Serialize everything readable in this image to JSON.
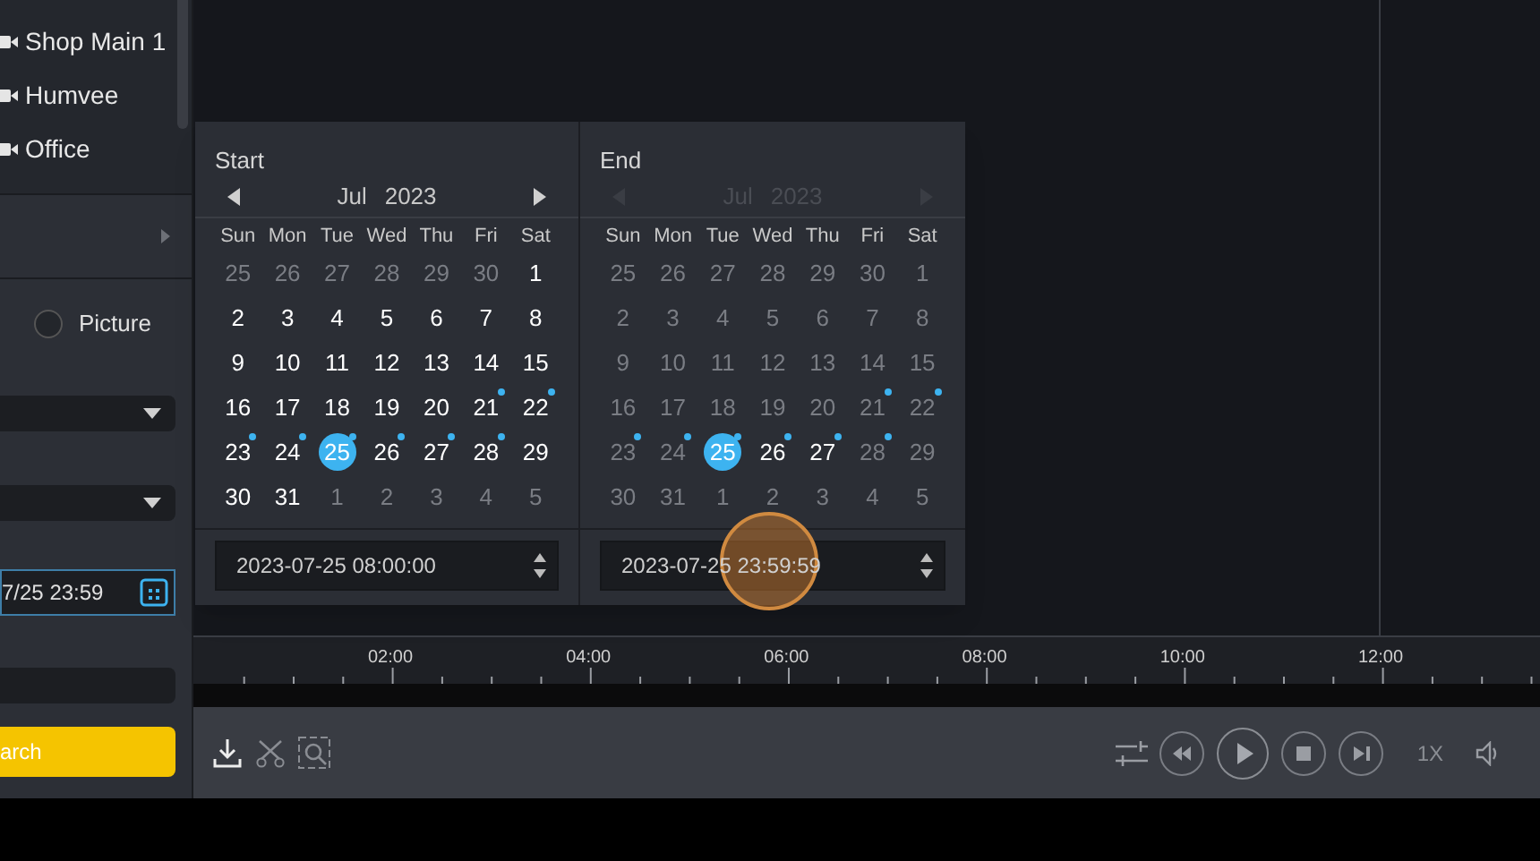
{
  "cameras": [
    {
      "label": "Shop Main 1"
    },
    {
      "label": "Humvee"
    },
    {
      "label": "Office"
    }
  ],
  "record_type": {
    "label": "Picture",
    "selected": false
  },
  "time_field": {
    "value": "7/25 23:59"
  },
  "search_button": {
    "label": "arch"
  },
  "calendars": [
    {
      "title": "Start",
      "month": "Jul",
      "year": "2023",
      "nav": true,
      "weekdays": [
        "Sun",
        "Mon",
        "Tue",
        "Wed",
        "Thu",
        "Fri",
        "Sat"
      ],
      "time": "2023-07-25 08:00:00",
      "days": [
        {
          "label": "25",
          "dim": true,
          "selected": false,
          "dot": false
        },
        {
          "label": "26",
          "dim": true,
          "selected": false,
          "dot": false
        },
        {
          "label": "27",
          "dim": true,
          "selected": false,
          "dot": false
        },
        {
          "label": "28",
          "dim": true,
          "selected": false,
          "dot": false
        },
        {
          "label": "29",
          "dim": true,
          "selected": false,
          "dot": false
        },
        {
          "label": "30",
          "dim": true,
          "selected": false,
          "dot": false
        },
        {
          "label": "1",
          "dim": false,
          "selected": false,
          "dot": false
        },
        {
          "label": "2",
          "dim": false,
          "selected": false,
          "dot": false
        },
        {
          "label": "3",
          "dim": false,
          "selected": false,
          "dot": false
        },
        {
          "label": "4",
          "dim": false,
          "selected": false,
          "dot": false
        },
        {
          "label": "5",
          "dim": false,
          "selected": false,
          "dot": false
        },
        {
          "label": "6",
          "dim": false,
          "selected": false,
          "dot": false
        },
        {
          "label": "7",
          "dim": false,
          "selected": false,
          "dot": false
        },
        {
          "label": "8",
          "dim": false,
          "selected": false,
          "dot": false
        },
        {
          "label": "9",
          "dim": false,
          "selected": false,
          "dot": false
        },
        {
          "label": "10",
          "dim": false,
          "selected": false,
          "dot": false
        },
        {
          "label": "11",
          "dim": false,
          "selected": false,
          "dot": false
        },
        {
          "label": "12",
          "dim": false,
          "selected": false,
          "dot": false
        },
        {
          "label": "13",
          "dim": false,
          "selected": false,
          "dot": false
        },
        {
          "label": "14",
          "dim": false,
          "selected": false,
          "dot": false
        },
        {
          "label": "15",
          "dim": false,
          "selected": false,
          "dot": false
        },
        {
          "label": "16",
          "dim": false,
          "selected": false,
          "dot": false
        },
        {
          "label": "17",
          "dim": false,
          "selected": false,
          "dot": false
        },
        {
          "label": "18",
          "dim": false,
          "selected": false,
          "dot": false
        },
        {
          "label": "19",
          "dim": false,
          "selected": false,
          "dot": false
        },
        {
          "label": "20",
          "dim": false,
          "selected": false,
          "dot": false
        },
        {
          "label": "21",
          "dim": false,
          "selected": false,
          "dot": true
        },
        {
          "label": "22",
          "dim": false,
          "selected": false,
          "dot": true
        },
        {
          "label": "23",
          "dim": false,
          "selected": false,
          "dot": true
        },
        {
          "label": "24",
          "dim": false,
          "selected": false,
          "dot": true
        },
        {
          "label": "25",
          "dim": false,
          "selected": true,
          "dot": true
        },
        {
          "label": "26",
          "dim": false,
          "selected": false,
          "dot": true
        },
        {
          "label": "27",
          "dim": false,
          "selected": false,
          "dot": true
        },
        {
          "label": "28",
          "dim": false,
          "selected": false,
          "dot": true
        },
        {
          "label": "29",
          "dim": false,
          "selected": false,
          "dot": false
        },
        {
          "label": "30",
          "dim": false,
          "selected": false,
          "dot": false
        },
        {
          "label": "31",
          "dim": false,
          "selected": false,
          "dot": false
        },
        {
          "label": "1",
          "dim": true,
          "selected": false,
          "dot": false
        },
        {
          "label": "2",
          "dim": true,
          "selected": false,
          "dot": false
        },
        {
          "label": "3",
          "dim": true,
          "selected": false,
          "dot": false
        },
        {
          "label": "4",
          "dim": true,
          "selected": false,
          "dot": false
        },
        {
          "label": "5",
          "dim": true,
          "selected": false,
          "dot": false
        }
      ]
    },
    {
      "title": "End",
      "month": "Jul",
      "year": "2023",
      "nav": false,
      "weekdays": [
        "Sun",
        "Mon",
        "Tue",
        "Wed",
        "Thu",
        "Fri",
        "Sat"
      ],
      "time": "2023-07-25 23:59:59",
      "days": [
        {
          "label": "25",
          "dim": true,
          "selected": false,
          "dot": false
        },
        {
          "label": "26",
          "dim": true,
          "selected": false,
          "dot": false
        },
        {
          "label": "27",
          "dim": true,
          "selected": false,
          "dot": false
        },
        {
          "label": "28",
          "dim": true,
          "selected": false,
          "dot": false
        },
        {
          "label": "29",
          "dim": true,
          "selected": false,
          "dot": false
        },
        {
          "label": "30",
          "dim": true,
          "selected": false,
          "dot": false
        },
        {
          "label": "1",
          "dim": true,
          "selected": false,
          "dot": false
        },
        {
          "label": "2",
          "dim": true,
          "selected": false,
          "dot": false
        },
        {
          "label": "3",
          "dim": true,
          "selected": false,
          "dot": false
        },
        {
          "label": "4",
          "dim": true,
          "selected": false,
          "dot": false
        },
        {
          "label": "5",
          "dim": true,
          "selected": false,
          "dot": false
        },
        {
          "label": "6",
          "dim": true,
          "selected": false,
          "dot": false
        },
        {
          "label": "7",
          "dim": true,
          "selected": false,
          "dot": false
        },
        {
          "label": "8",
          "dim": true,
          "selected": false,
          "dot": false
        },
        {
          "label": "9",
          "dim": true,
          "selected": false,
          "dot": false
        },
        {
          "label": "10",
          "dim": true,
          "selected": false,
          "dot": false
        },
        {
          "label": "11",
          "dim": true,
          "selected": false,
          "dot": false
        },
        {
          "label": "12",
          "dim": true,
          "selected": false,
          "dot": false
        },
        {
          "label": "13",
          "dim": true,
          "selected": false,
          "dot": false
        },
        {
          "label": "14",
          "dim": true,
          "selected": false,
          "dot": false
        },
        {
          "label": "15",
          "dim": true,
          "selected": false,
          "dot": false
        },
        {
          "label": "16",
          "dim": true,
          "selected": false,
          "dot": false
        },
        {
          "label": "17",
          "dim": true,
          "selected": false,
          "dot": false
        },
        {
          "label": "18",
          "dim": true,
          "selected": false,
          "dot": false
        },
        {
          "label": "19",
          "dim": true,
          "selected": false,
          "dot": false
        },
        {
          "label": "20",
          "dim": true,
          "selected": false,
          "dot": false
        },
        {
          "label": "21",
          "dim": true,
          "selected": false,
          "dot": true
        },
        {
          "label": "22",
          "dim": true,
          "selected": false,
          "dot": true
        },
        {
          "label": "23",
          "dim": true,
          "selected": false,
          "dot": true
        },
        {
          "label": "24",
          "dim": true,
          "selected": false,
          "dot": true
        },
        {
          "label": "25",
          "dim": false,
          "selected": true,
          "dot": true
        },
        {
          "label": "26",
          "dim": false,
          "selected": false,
          "dot": true
        },
        {
          "label": "27",
          "dim": false,
          "selected": false,
          "dot": true
        },
        {
          "label": "28",
          "dim": true,
          "selected": false,
          "dot": true
        },
        {
          "label": "29",
          "dim": true,
          "selected": false,
          "dot": false
        },
        {
          "label": "30",
          "dim": true,
          "selected": false,
          "dot": false
        },
        {
          "label": "31",
          "dim": true,
          "selected": false,
          "dot": false
        },
        {
          "label": "1",
          "dim": true,
          "selected": false,
          "dot": false
        },
        {
          "label": "2",
          "dim": true,
          "selected": false,
          "dot": false
        },
        {
          "label": "3",
          "dim": true,
          "selected": false,
          "dot": false
        },
        {
          "label": "4",
          "dim": true,
          "selected": false,
          "dot": false
        },
        {
          "label": "5",
          "dim": true,
          "selected": false,
          "dot": false
        }
      ]
    }
  ],
  "timeline": {
    "ticks": [
      "02:00",
      "04:00",
      "06:00",
      "08:00",
      "10:00",
      "12:00"
    ]
  },
  "playback": {
    "speed": "1X"
  }
}
